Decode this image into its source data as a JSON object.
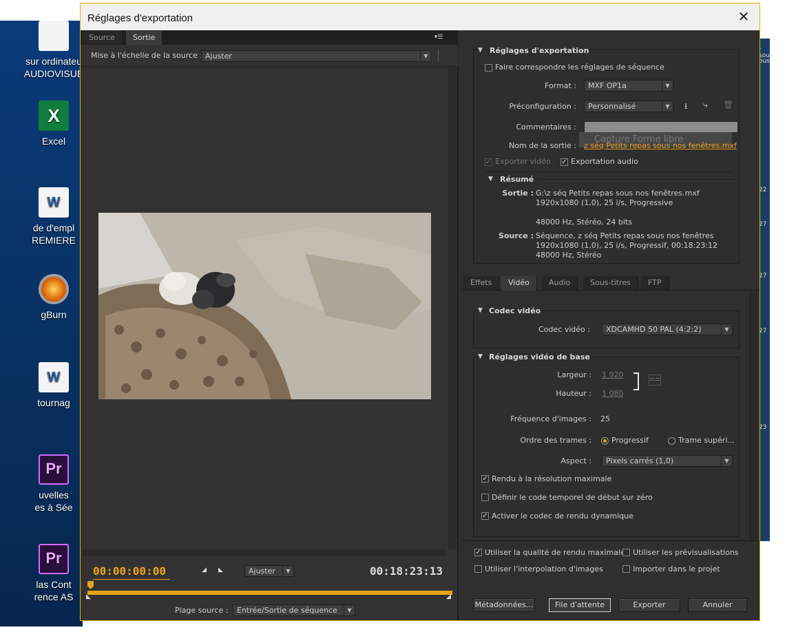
{
  "desktop": {
    "icons": [
      {
        "icon": "shortcut-icon",
        "label_lines": [
          "sur ordinateu",
          "AUDIOVISUE"
        ]
      },
      {
        "icon": "excel-icon",
        "label_lines": [
          "Excel"
        ]
      },
      {
        "icon": "word-doc-icon",
        "label_lines": [
          "de d'empl",
          "REMIERE"
        ]
      },
      {
        "icon": "imgburn-icon",
        "label_lines": [
          "gBurn"
        ]
      },
      {
        "icon": "word-doc-icon",
        "label_lines": [
          "tournag"
        ]
      },
      {
        "icon": "premiere-project-icon",
        "label_lines": [
          "uvelles",
          "es à Sée"
        ]
      },
      {
        "icon": "premiere-project-icon",
        "label_lines": [
          "las Cont",
          "rence AS"
        ]
      }
    ],
    "right_edge_fragments": [
      "- sous",
      "ous",
      "22",
      "27",
      "27",
      "27",
      "23"
    ]
  },
  "dialog": {
    "title": "Réglages d'exportation",
    "close_glyph": "✕"
  },
  "left_panel": {
    "tabs": [
      "Source",
      "Sortie"
    ],
    "active_tab": "Sortie",
    "panel_menu_glyph": "▾☰",
    "scale_label": "Mise à l'échelle de la source :",
    "scale_value": "Ajuster",
    "timecode_in": "00:00:00:00",
    "fit_value": "Ajuster",
    "timecode_out": "00:18:23:13",
    "source_range_label": "Plage source :",
    "source_range_value": "Entrée/Sortie de séquence"
  },
  "export_settings": {
    "section_title": "Réglages d'exportation",
    "match_sequence_label": "Faire correspondre les réglages de séquence",
    "format_label": "Format :",
    "format_value": "MXF OP1a",
    "preset_label": "Préconfiguration :",
    "preset_value": "Personnalisé",
    "comments_label": "Commentaires :",
    "comments_ghost": "Capture Forme libre",
    "output_name_label": "Nom de la sortie :",
    "output_name_value": "z séq Petits repas sous nos fenêtres.mxf",
    "export_video_label": "Exporter vidéo",
    "export_audio_label": "Exportation audio",
    "summary_title": "Résumé",
    "output_label": "Sortie :",
    "output_lines": [
      "G:\\z séq Petits repas sous nos fenêtres.mxf",
      "1920x1080 (1,0), 25 i/s, Progressive",
      "",
      "48000  Hz, Stéréo, 24 bits"
    ],
    "source_label": "Source :",
    "source_lines": [
      "Séquence, z séq Petits repas sous nos fenêtres",
      "1920x1080 (1,0), 25  i/s, Progressif, 00:18:23:12",
      "48000 Hz, Stéréo"
    ]
  },
  "settings_tabs": [
    "Effets",
    "Vidéo",
    "Audio",
    "Sous-titres",
    "FTP"
  ],
  "active_settings_tab": "Vidéo",
  "video": {
    "codec_section": "Codec vidéo",
    "codec_label": "Codec vidéo :",
    "codec_value": "XDCAMHD 50 PAL (4:2:2)",
    "basic_section": "Réglages vidéo de base",
    "width_label": "Largeur :",
    "width_value": "1 920",
    "height_label": "Hauteur :",
    "height_value": "1 080",
    "framerate_label": "Fréquence d'images :",
    "framerate_value": "25",
    "field_order_label": "Ordre des trames :",
    "field_progressive": "Progressif",
    "field_upper": "Trame supéri...",
    "aspect_label": "Aspect :",
    "aspect_value": "Pixels carrés (1,0)",
    "max_depth_label": "Rendu à la résolution maximale",
    "zero_tc_label": "Définir le code temporel de début sur zéro",
    "dynamic_codec_label": "Activer le codec de rendu dynamique"
  },
  "bottom": {
    "max_quality_label": "Utiliser la qualité de rendu maximale",
    "use_previews_label": "Utiliser les prévisualisations",
    "frame_blend_label": "Utiliser l'interpolation d'images",
    "import_project_label": "Importer dans le projet",
    "metadata_button": "Métadonnées...",
    "queue_button": "File d'attente",
    "export_button": "Exporter",
    "cancel_button": "Annuler"
  }
}
